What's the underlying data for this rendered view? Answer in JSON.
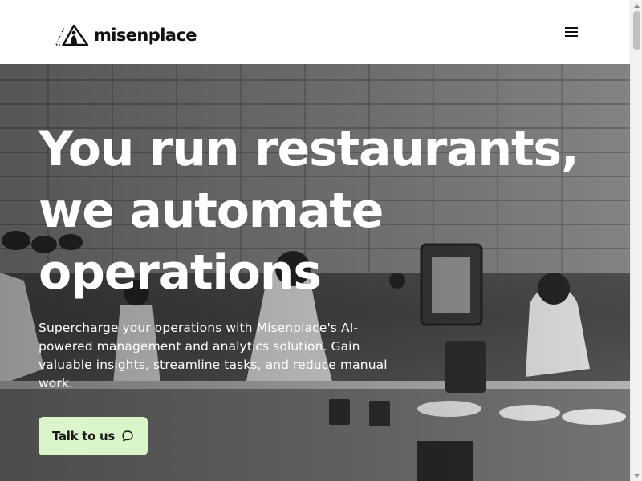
{
  "header": {
    "logo_text": "misenplace",
    "logo_icon": "tent-peak-logo-icon",
    "menu_icon": "hamburger-menu-icon"
  },
  "hero": {
    "title_lines": [
      "You run restaurants,",
      "we automate",
      "operations"
    ],
    "subtitle": "Supercharge your operations with Misenplace's AI-powered management and analytics solution. Gain valuable insights, streamline tasks, and reduce manual work.",
    "cta": {
      "label": "Talk to us",
      "icon": "chat-bubble-icon"
    },
    "background": "restaurant-kitchen-photo"
  },
  "colors": {
    "cta_background": "#d9f5c9",
    "header_background": "#ffffff",
    "hero_text": "#ffffff",
    "brand_text": "#111111"
  }
}
